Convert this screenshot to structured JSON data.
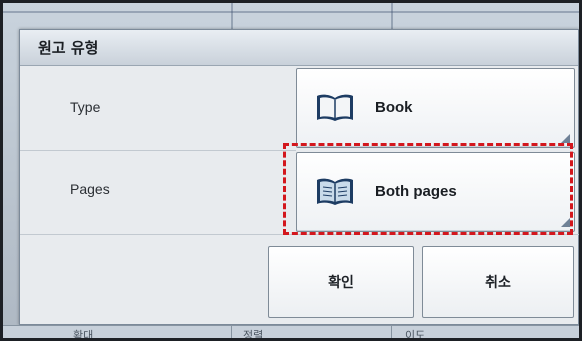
{
  "dialog": {
    "title": "원고 유형",
    "rows": [
      {
        "label": "Type",
        "value": "Book",
        "icon": "open-book-icon"
      },
      {
        "label": "Pages",
        "value": "Both pages",
        "icon": "open-book-both-pages-icon"
      }
    ],
    "ok_label": "확인",
    "cancel_label": "취소"
  },
  "highlight_color": "#d3171d",
  "background_tabs": [
    "확대",
    "정렬",
    "이도"
  ]
}
